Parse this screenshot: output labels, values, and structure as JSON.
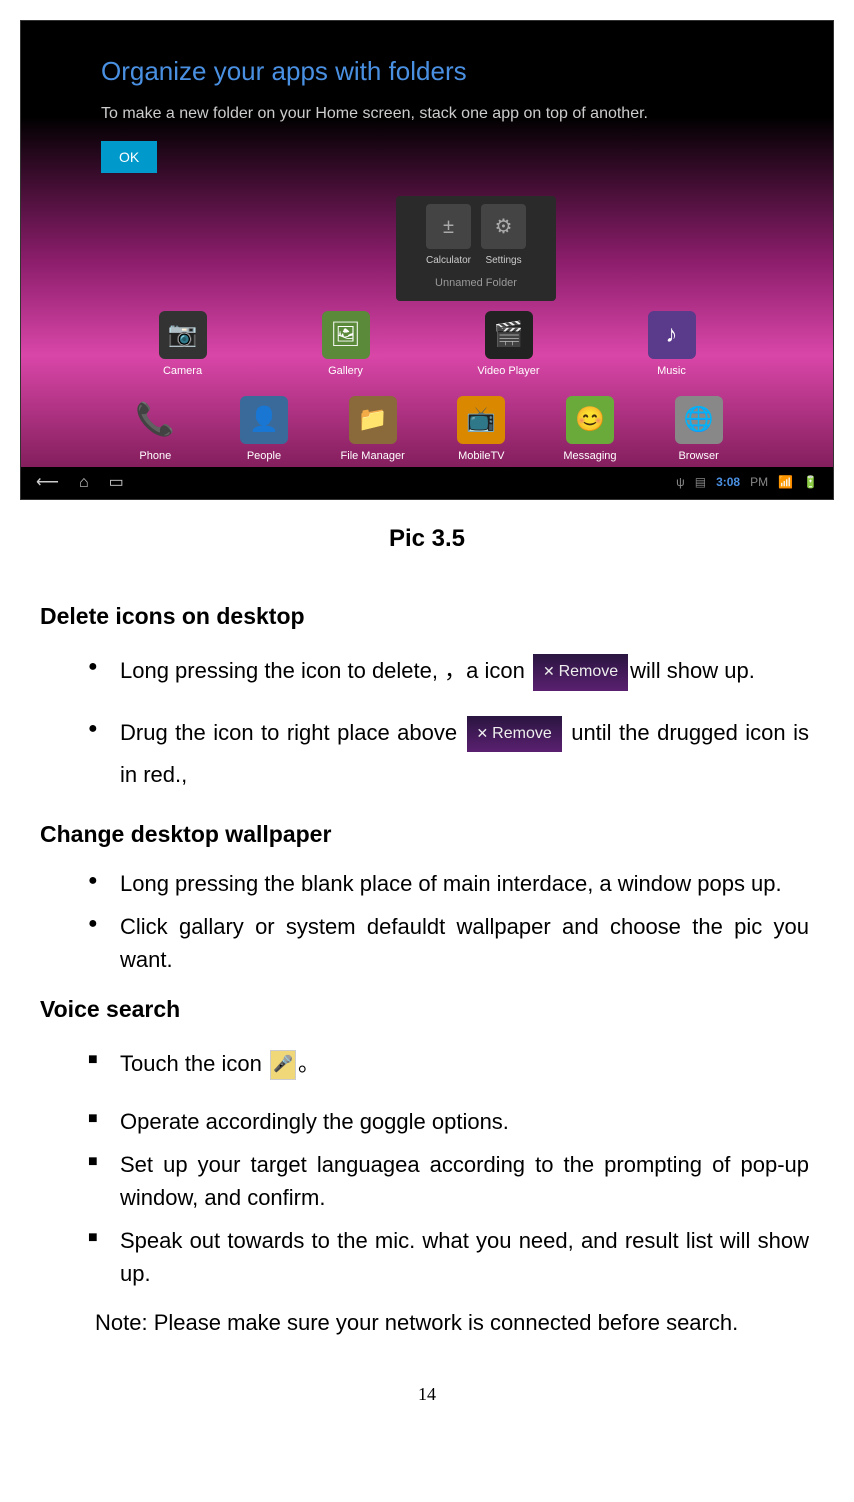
{
  "screenshot": {
    "tooltip": {
      "title": "Organize your apps with folders",
      "subtitle": "To make a new folder on your Home screen, stack one app on top of another.",
      "ok_button": "OK"
    },
    "folder": {
      "app1": "Calculator",
      "app2": "Settings",
      "label": "Unnamed Folder"
    },
    "apps_row1": {
      "camera": "Camera",
      "gallery": "Gallery",
      "video": "Video Player",
      "music": "Music"
    },
    "apps_row2": {
      "phone": "Phone",
      "people": "People",
      "file": "File Manager",
      "mobiletv": "MobileTV",
      "messaging": "Messaging",
      "browser": "Browser"
    },
    "navbar": {
      "time": "3:08",
      "pm": "PM"
    }
  },
  "caption": "Pic 3.5",
  "sections": {
    "delete": {
      "heading": "Delete icons on desktop",
      "bullet1_a": "Long pressing the icon to delete, ，a icon ",
      "bullet1_b": "will show up.",
      "remove_label": "Remove",
      "bullet2_a": "Drug the icon to right place above ",
      "bullet2_b": " until the drugged icon is in red.,"
    },
    "wallpaper": {
      "heading": "Change desktop wallpaper",
      "bullet1": "Long pressing the blank place of main interdace,  a window pops up.",
      "bullet2": "Click gallary or system defauldt wallpaper and choose the pic you want."
    },
    "voice": {
      "heading": "Voice search",
      "bullet1": "Touch the icon ",
      "bullet1_end": "。",
      "bullet2": "Operate accordingly the goggle options.",
      "bullet3": " Set up your target languagea according to the prompting of pop-up window, and confirm.",
      "bullet4": "Speak out towards to the mic. what you need, and result list will show up."
    },
    "note": "Note: Please make sure your network is connected before search."
  },
  "page_number": "14"
}
